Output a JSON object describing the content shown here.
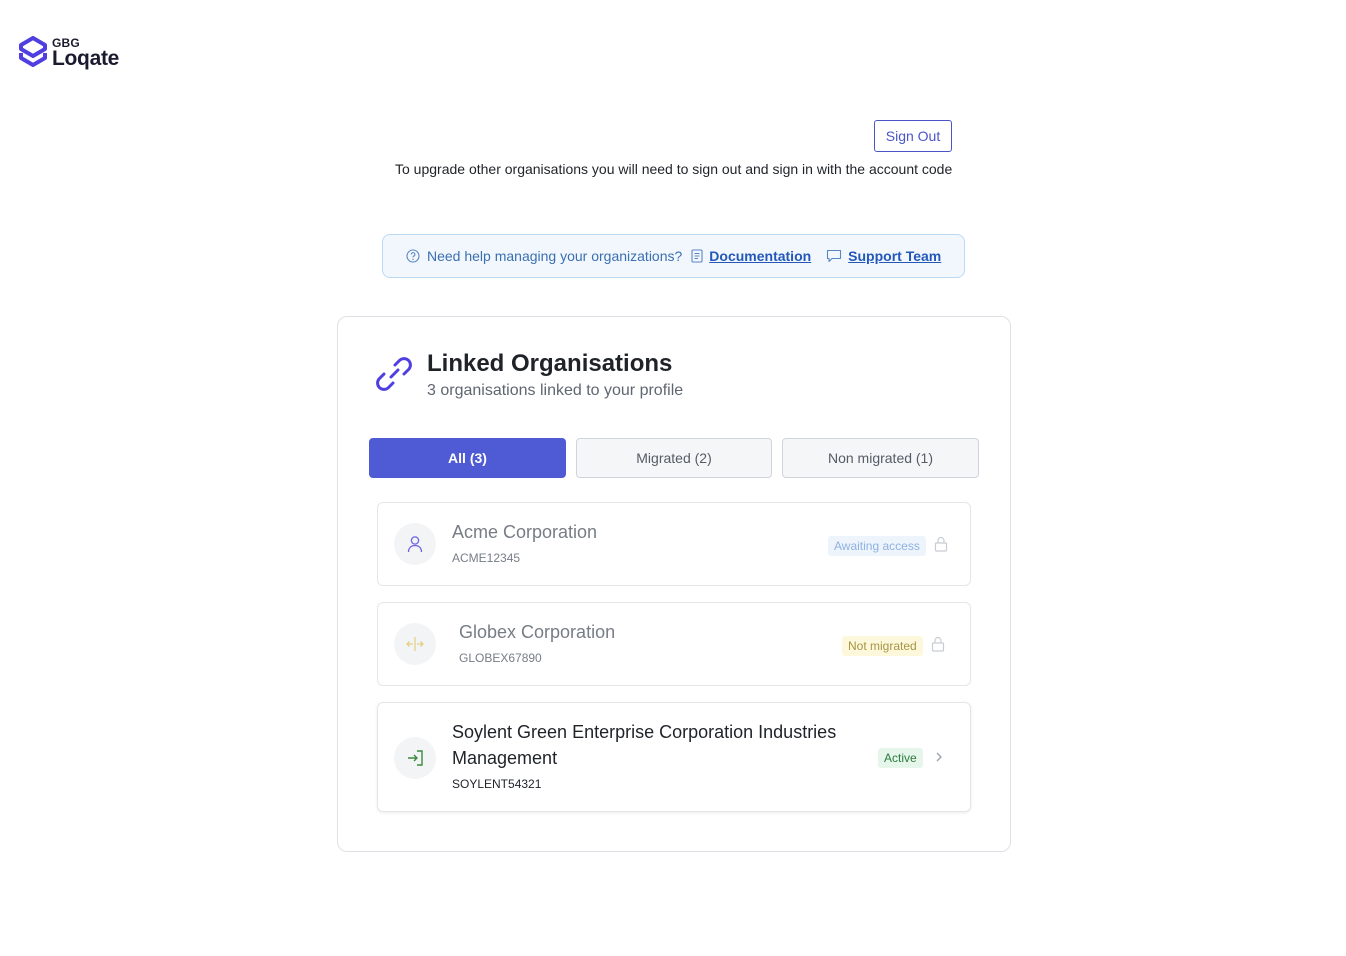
{
  "brand": {
    "small": "GBG",
    "name": "Loqate",
    "color": "#4f3fe0"
  },
  "header": {
    "sign_out_label": "Sign Out",
    "upgrade_note": "To upgrade other organisations you will need to sign out and sign in with the account code"
  },
  "help": {
    "icon": "question-circle-icon",
    "text": "Need help managing your organizations?",
    "documentation_label": "Documentation",
    "support_label": "Support Team"
  },
  "linked": {
    "title": "Linked Organisations",
    "subtitle": "3 organisations linked to your profile",
    "tabs": [
      {
        "label": "All (3)",
        "active": true
      },
      {
        "label": "Migrated (2)",
        "active": false
      },
      {
        "label": "Non migrated (1)",
        "active": false
      }
    ],
    "orgs": [
      {
        "name": "Acme Corporation",
        "code": "ACME12345",
        "status": "Awaiting access",
        "icon": "user-icon",
        "trailing": "lock-icon"
      },
      {
        "name": "Globex Corporation",
        "code": "GLOBEX67890",
        "status": "Not migrated",
        "icon": "split-arrows-icon",
        "trailing": "lock-icon"
      },
      {
        "name": "Soylent Green Enterprise Corporation Industries Management",
        "code": "SOYLENT54321",
        "status": "Active",
        "icon": "sign-in-icon",
        "trailing": "chevron-right-icon"
      }
    ]
  },
  "colors": {
    "accent": "#4f5bd5",
    "help_bg": "#f1f7fd",
    "active_badge": "#e6f6ea",
    "not_migrated_badge": "#fdf8dc",
    "awaiting_badge": "#eef4fc"
  }
}
